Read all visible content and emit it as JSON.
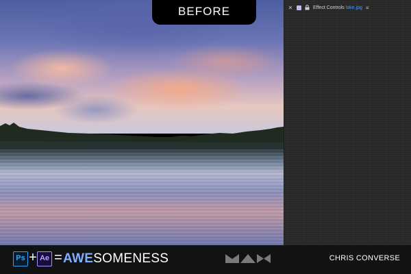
{
  "overlay": {
    "before_label": "BEFORE"
  },
  "effect_controls": {
    "title_prefix": "Effect Controls",
    "file_name": "lake.jpg",
    "close_icon": "close-icon",
    "menu_icon": "panel-menu-icon"
  },
  "footer": {
    "ps_badge": "Ps",
    "plus": "+",
    "ae_badge": "Ae",
    "equals": "=",
    "tagline_bold": "AWE",
    "tagline_rest": "SOMENESS",
    "author": "CHRIS CONVERSE"
  },
  "colors": {
    "panel_bg": "#2a2a2a",
    "file_link": "#3f9bff",
    "awe_blue": "#7fb0ff",
    "ps_blue": "#31a8ff",
    "ae_purple": "#a8a8ff"
  }
}
